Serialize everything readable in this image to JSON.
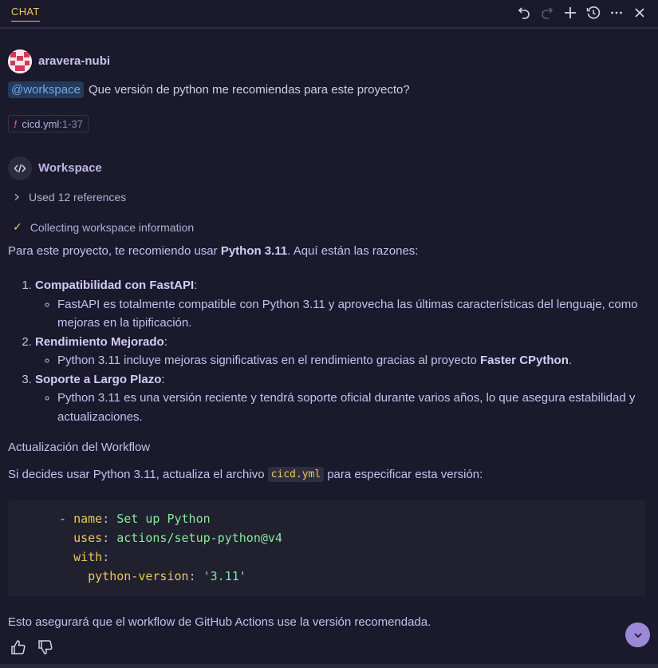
{
  "header": {
    "tab_label": "CHAT",
    "actions": [
      "undo-icon",
      "redo-icon",
      "new-chat-icon",
      "history-icon",
      "more-icon",
      "close-icon"
    ]
  },
  "user_message": {
    "username": "aravera-nubi",
    "mention": "@workspace",
    "text": "Que versión de python me recomiendas para este proyecto?",
    "file_ref": {
      "name": "cicd.yml",
      "range": ":1-37"
    }
  },
  "response": {
    "agent_name": "Workspace",
    "references_label": "Used 12 references",
    "progress_label": "Collecting workspace information",
    "intro_prefix": "Para este proyecto, te recomiendo usar ",
    "intro_bold": "Python 3.11",
    "intro_suffix": ". Aquí están las razones:",
    "reasons": [
      {
        "title": "Compatibilidad con FastAPI",
        "colon": ":",
        "detail": "FastAPI es totalmente compatible con Python 3.11 y aprovecha las últimas características del lenguaje, como mejoras en la tipificación."
      },
      {
        "title": "Rendimiento Mejorado",
        "colon": ":",
        "detail_prefix": "Python 3.11 incluye mejoras significativas en el rendimiento gracias al proyecto ",
        "detail_bold": "Faster CPython",
        "detail_suffix": "."
      },
      {
        "title": "Soporte a Largo Plazo",
        "colon": ":",
        "detail": "Python 3.11 es una versión reciente y tendrá soporte oficial durante varios años, lo que asegura estabilidad y actualizaciones."
      }
    ],
    "workflow_title": "Actualización del Workflow",
    "update_prefix": "Si decides usar Python 3.11, actualiza el archivo ",
    "update_code": "cicd.yml",
    "update_suffix": " para especificar esta versión:",
    "code": {
      "dash": "- ",
      "name_key": "name",
      "name_val": "Set up Python",
      "uses_key": "uses",
      "uses_val": "actions/setup-python@v4",
      "with_key": "with",
      "pv_key": "python-version",
      "pv_val": "'3.11'",
      "colon": ":"
    },
    "closing": "Esto asegurará que el workflow de GitHub Actions use la versión recomendada."
  },
  "colors": {
    "background": "#1a1a2c",
    "accent": "#e9c95b",
    "mention": "#6fa8e8",
    "scroll_button": "#9d88d8"
  }
}
